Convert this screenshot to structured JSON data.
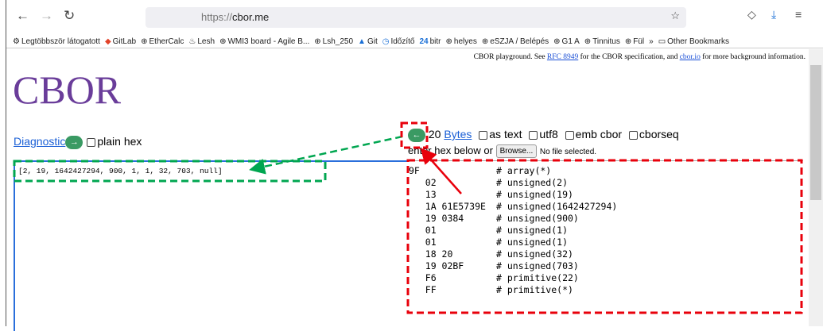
{
  "browser": {
    "url_prefix": "https://",
    "url_host": "cbor.me",
    "bookmarks": [
      "Legtöbbször látogatott",
      "GitLab",
      "EtherCalc",
      "Lesh",
      "WMI3 board - Agile B...",
      "Lsh_250",
      "Git",
      "Időzítő",
      "bitr",
      "helyes",
      "eSZJA / Belépés",
      "G1 A",
      "Tinnitus",
      "Fül"
    ],
    "bitr_badge": "24",
    "more": "»",
    "other_bookmarks": "Other Bookmarks"
  },
  "page": {
    "info_pre": "CBOR playground. See ",
    "info_link1": "RFC 8949",
    "info_mid": " for the CBOR specification, and ",
    "info_link2": "cbor.io",
    "info_post": " for more background information.",
    "logo": "CBOR",
    "left": {
      "diagnostic_link": "Diagnostic",
      "to_right": "→",
      "plain_hex": "plain hex",
      "value": "[2, 19, 1642427294, 900, 1, 1, 32, 703, null]"
    },
    "right": {
      "to_left": "←",
      "count": "20",
      "bytes_link": "Bytes",
      "options": [
        "as text",
        "utf8",
        "emb cbor",
        "cborseq"
      ],
      "enter_hex": "enter hex below or",
      "browse": "Browse...",
      "no_file": "No file selected.",
      "lines": [
        [
          "9F",
          "# array(*)"
        ],
        [
          "   02",
          "# unsigned(2)"
        ],
        [
          "   13",
          "# unsigned(19)"
        ],
        [
          "   1A 61E5739E",
          "# unsigned(1642427294)"
        ],
        [
          "   19 0384",
          "# unsigned(900)"
        ],
        [
          "   01",
          "# unsigned(1)"
        ],
        [
          "   01",
          "# unsigned(1)"
        ],
        [
          "   18 20",
          "# unsigned(32)"
        ],
        [
          "   19 02BF",
          "# unsigned(703)"
        ],
        [
          "   F6",
          "# primitive(22)"
        ],
        [
          "   FF",
          "# primitive(*)"
        ]
      ]
    }
  },
  "colors": {
    "annotation_red": "#e8000b",
    "annotation_green": "#00a650",
    "logo": "#6a3d9a"
  }
}
